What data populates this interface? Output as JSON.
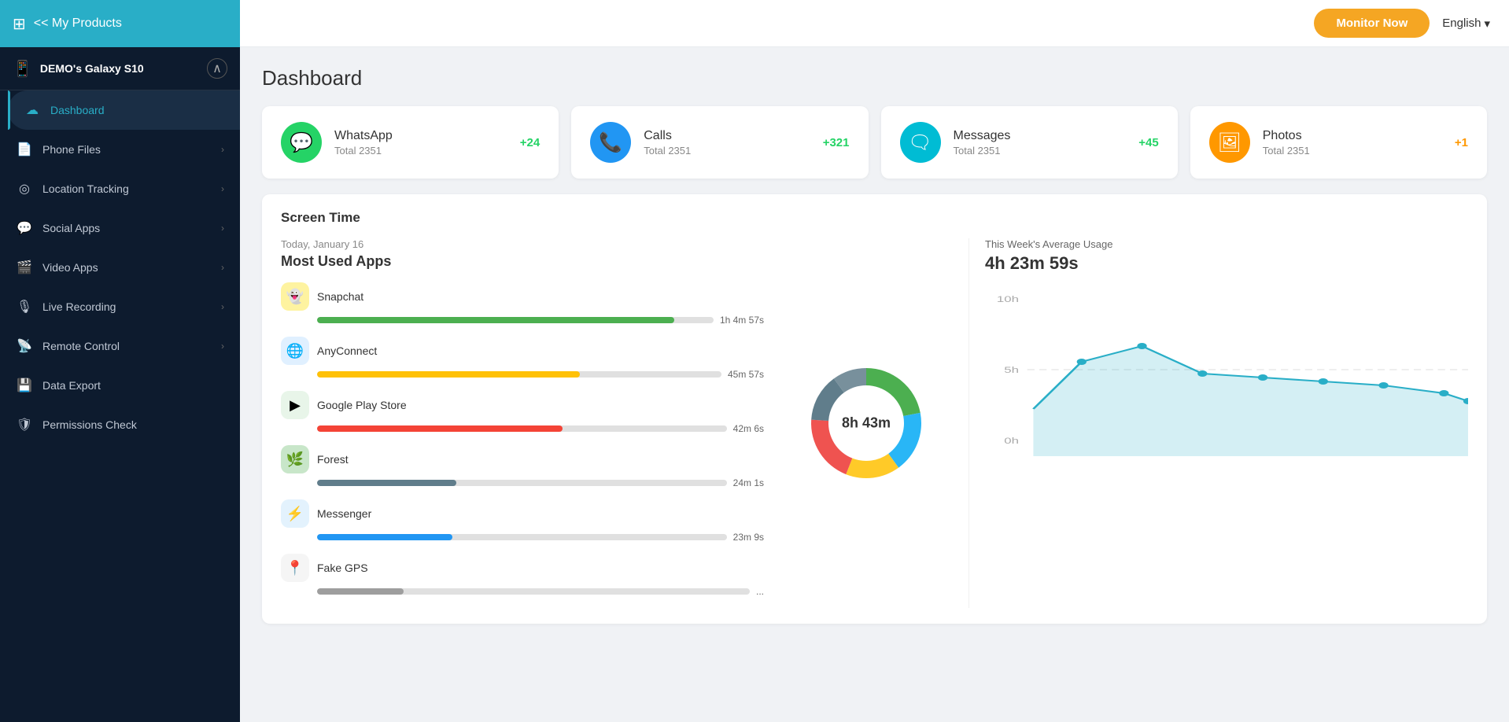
{
  "sidebar": {
    "header": {
      "icon": "⊞",
      "label": "<< My Products"
    },
    "device": {
      "name": "DEMO's Galaxy S10"
    },
    "nav_items": [
      {
        "id": "dashboard",
        "icon": "⬆",
        "label": "Dashboard",
        "active": true
      },
      {
        "id": "phone-files",
        "icon": "📄",
        "label": "Phone Files",
        "chevron": true
      },
      {
        "id": "location-tracking",
        "icon": "◎",
        "label": "Location Tracking",
        "chevron": true
      },
      {
        "id": "social-apps",
        "icon": "💬",
        "label": "Social Apps",
        "chevron": true
      },
      {
        "id": "video-apps",
        "icon": "🎬",
        "label": "Video Apps",
        "chevron": true
      },
      {
        "id": "live-recording",
        "icon": "🎙",
        "label": "Live Recording",
        "chevron": true
      },
      {
        "id": "remote-control",
        "icon": "📡",
        "label": "Remote Control",
        "chevron": true
      },
      {
        "id": "data-export",
        "icon": "💾",
        "label": "Data Export",
        "chevron": false
      },
      {
        "id": "permissions-check",
        "icon": "🛡",
        "label": "Permissions Check",
        "chevron": false
      }
    ]
  },
  "topbar": {
    "monitor_now": "Monitor Now",
    "language": "English"
  },
  "dashboard": {
    "title": "Dashboard",
    "stats": [
      {
        "name": "WhatsApp",
        "total_label": "Total 2351",
        "delta": "+24",
        "icon_color": "green",
        "icon": "💬"
      },
      {
        "name": "Calls",
        "total_label": "Total 2351",
        "delta": "+321",
        "icon_color": "blue",
        "icon": "📞"
      },
      {
        "name": "Messages",
        "total_label": "Total 2351",
        "delta": "+45",
        "icon_color": "teal",
        "icon": "💬"
      },
      {
        "name": "Photos",
        "total_label": "Total 2351",
        "delta": "+1",
        "icon_color": "orange",
        "icon": "🖼"
      }
    ],
    "screen_time": {
      "title": "Screen Time",
      "date_label": "Today, January 16",
      "most_used_title": "Most Used Apps",
      "apps": [
        {
          "name": "Snapchat",
          "time": "1h 4m 57s",
          "bar_pct": 90,
          "bar_color": "#4caf50",
          "icon": "👻",
          "bg": "#ffeb3b"
        },
        {
          "name": "AnyConnect",
          "time": "45m 57s",
          "bar_pct": 65,
          "bar_color": "#ffc107",
          "icon": "🌐",
          "bg": "#e0f0ff"
        },
        {
          "name": "Google Play Store",
          "time": "42m 6s",
          "bar_pct": 60,
          "bar_color": "#f44336",
          "icon": "▶",
          "bg": "#e8f5e9"
        },
        {
          "name": "Forest",
          "time": "24m 1s",
          "bar_pct": 34,
          "bar_color": "#607d8b",
          "icon": "🌿",
          "bg": "#c8e6c9"
        },
        {
          "name": "Messenger",
          "time": "23m 9s",
          "bar_pct": 33,
          "bar_color": "#2196f3",
          "icon": "⚡",
          "bg": "#e3f2fd"
        },
        {
          "name": "Fake GPS",
          "time": "...",
          "bar_pct": 20,
          "bar_color": "#9e9e9e",
          "icon": "📍",
          "bg": "#f5f5f5"
        }
      ],
      "donut": {
        "center_label": "8h 43m",
        "segments": [
          {
            "color": "#4caf50",
            "pct": 22
          },
          {
            "color": "#29b6f6",
            "pct": 18
          },
          {
            "color": "#ffca28",
            "pct": 16
          },
          {
            "color": "#ef5350",
            "pct": 20
          },
          {
            "color": "#607d8b",
            "pct": 14
          },
          {
            "color": "#78909c",
            "pct": 10
          }
        ]
      },
      "weekly": {
        "title": "This Week's Average Usage",
        "value": "4h 23m 59s",
        "y_labels": [
          "10h",
          "5h",
          "0h"
        ],
        "chart_color": "#29aec7"
      }
    }
  }
}
